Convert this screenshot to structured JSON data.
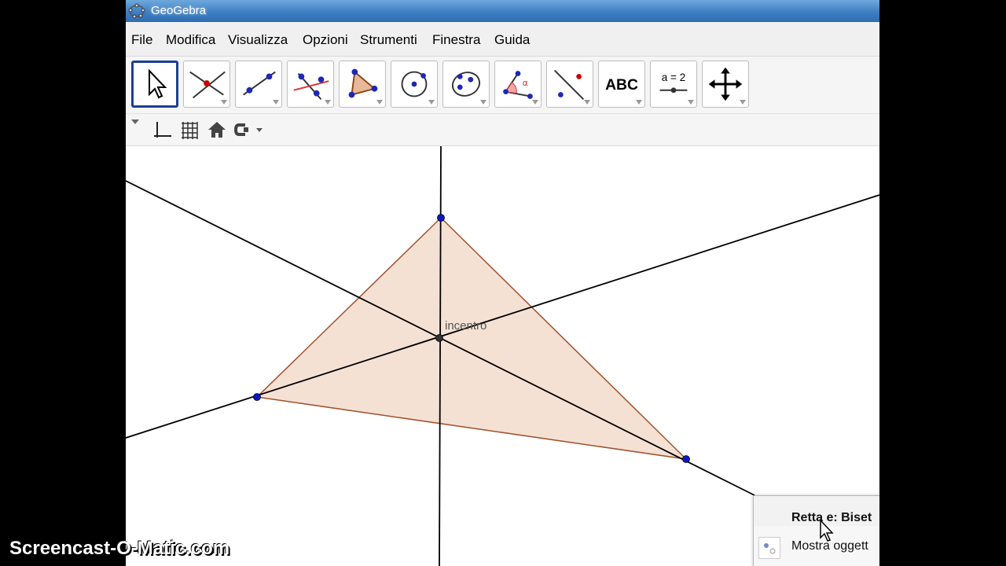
{
  "window": {
    "title": "GeoGebra"
  },
  "menu": [
    "File",
    "Modifica",
    "Visualizza",
    "Opzioni",
    "Strumenti",
    "Finestra",
    "Guida"
  ],
  "toolbar": {
    "tools": [
      {
        "name": "move-tool-icon",
        "active": true
      },
      {
        "name": "intersect-point-tool-icon"
      },
      {
        "name": "line-tool-icon"
      },
      {
        "name": "perpendicular-tool-icon"
      },
      {
        "name": "polygon-tool-icon"
      },
      {
        "name": "circle-tool-icon"
      },
      {
        "name": "ellipse-tool-icon"
      },
      {
        "name": "angle-tool-icon"
      },
      {
        "name": "reflect-tool-icon"
      },
      {
        "name": "text-tool-icon",
        "label": "ABC"
      },
      {
        "name": "slider-tool-icon",
        "label": "a = 2"
      },
      {
        "name": "move-view-tool-icon"
      }
    ]
  },
  "stylebar": [
    "axes-toggle-icon",
    "grid-toggle-icon",
    "home-view-icon",
    "point-capture-icon"
  ],
  "canvas": {
    "incenter_label": "incentro",
    "colors": {
      "line": "#000000",
      "polygon_fill": "#f3dccd",
      "polygon_stroke": "#a0522d",
      "point": "#0b18c8"
    }
  },
  "popup": {
    "title": "Retta e: Biset",
    "item": "Mostra oggett"
  },
  "watermark": "Screencast-O-Matic.com"
}
